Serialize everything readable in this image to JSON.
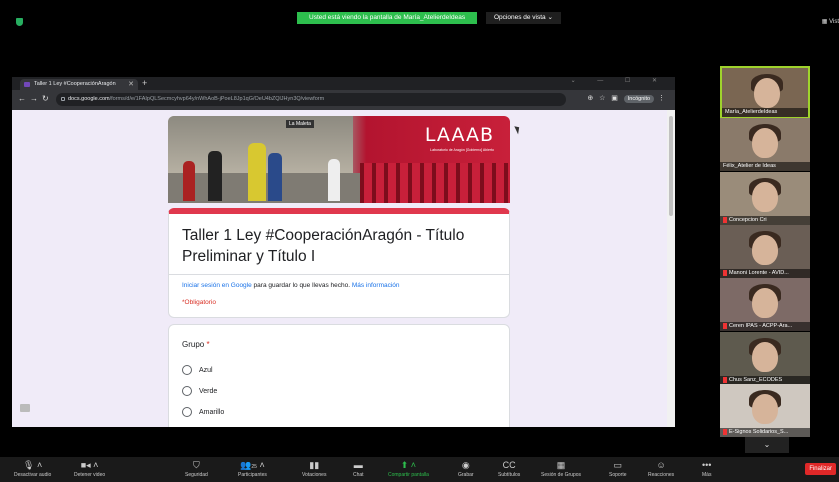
{
  "zoom": {
    "share_banner": "Usted está viendo la pantalla de María_AtelierdeIdeas",
    "view_options": "Opciones de vista ⌄",
    "view_top": "▦ Vist"
  },
  "browser": {
    "tab_title": "Taller 1 Ley #CooperaciónAragón",
    "new_tab": "+",
    "url_host": "docs.google.com",
    "url_path": "/forms/d/e/1FAIpQLSecmcyhvp64y/nWhAoB-jPoeL8Jp1qG/OeU4bZQlJHyn3Q/viewform",
    "incognito_label": "Incógnito",
    "window_controls": "⌄ — ☐ ✕"
  },
  "form": {
    "banner_logo": "LAAAB",
    "banner_logo_sub": "Laboratorio de Aragón [Gobierno] Abierto",
    "banner_sign": "La Maleta",
    "title": "Taller 1 Ley #CooperaciónAragón - Título Preliminar y Título I",
    "signin_link": "Iniciar sesión en Google",
    "signin_middle": " para guardar lo que llevas hecho. ",
    "more_info_link": "Más información",
    "required_note": "*Obligatorio",
    "question": {
      "label": "Grupo",
      "required_star": " *",
      "options": [
        "Azul",
        "Verde",
        "Amarillo"
      ]
    }
  },
  "participants": [
    {
      "name": "María_AtelierdeIdeas",
      "muted": false,
      "active": true
    },
    {
      "name": "Félix_Atelier de Ideas",
      "muted": false,
      "active": false
    },
    {
      "name": "Concepcion Cri",
      "muted": true,
      "active": false
    },
    {
      "name": "Manoni Lorente - AVID...",
      "muted": true,
      "active": false
    },
    {
      "name": "Ceren IPAS - ACPP-Ara...",
      "muted": true,
      "active": false
    },
    {
      "name": "Chus Sanz_ECODES",
      "muted": true,
      "active": false
    },
    {
      "name": "E-Signos Solidarios_S...",
      "muted": true,
      "active": false
    }
  ],
  "toolbar": {
    "audio": "Desactivar audio",
    "video": "Detener video",
    "security": "Seguridad",
    "participants": "Participantes",
    "participants_count": "25",
    "polls": "Votaciones",
    "chat": "Chat",
    "share": "Compartir pantalla",
    "record": "Grabar",
    "subtitles": "Subtítulos",
    "breakout": "Sesión de Grupos",
    "reactions_soporte": "Soporte",
    "reactions": "Reacciones",
    "more": "Más",
    "end": "Finalizar"
  }
}
